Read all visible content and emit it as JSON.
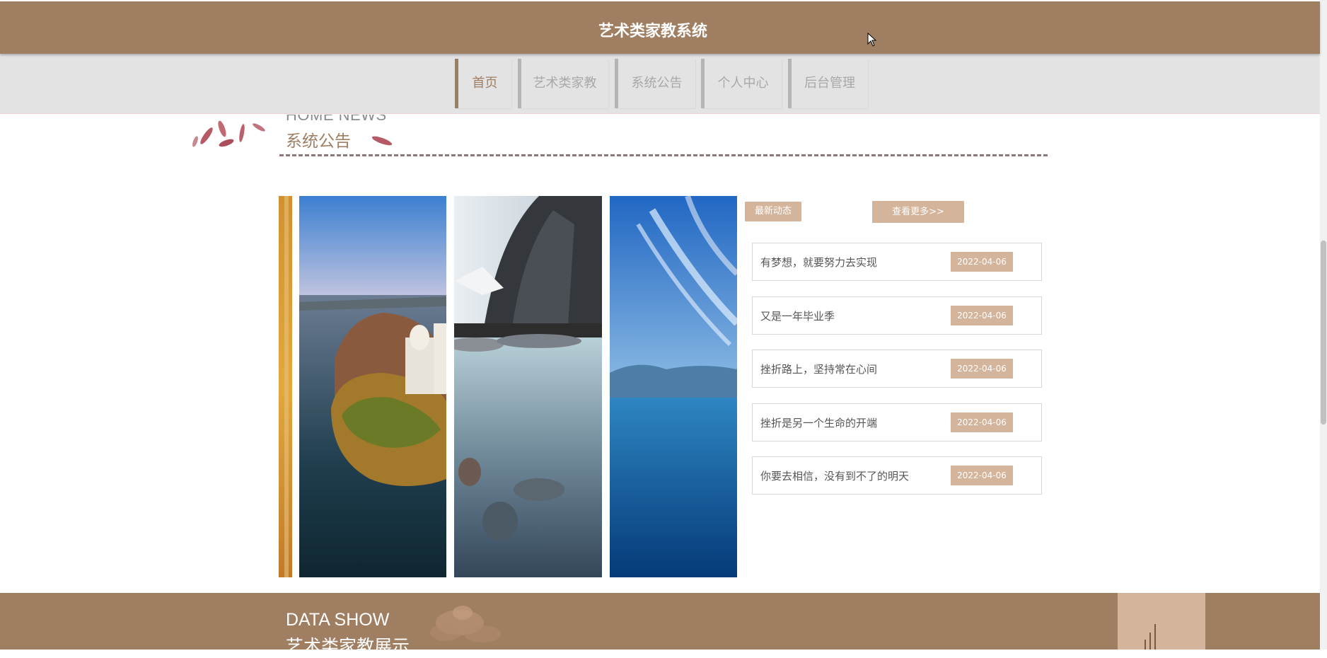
{
  "header": {
    "title": "艺术类家教系统"
  },
  "nav": [
    {
      "label": "首页",
      "active": true
    },
    {
      "label": "艺术类家教",
      "active": false
    },
    {
      "label": "系统公告",
      "active": false
    },
    {
      "label": "个人中心",
      "active": false
    },
    {
      "label": "后台管理",
      "active": false
    }
  ],
  "news_section": {
    "title_en": "HOME NEWS",
    "title_cn": "系统公告",
    "latest_label": "最新动态",
    "more_label": "查看更多>>",
    "items": [
      {
        "title": "有梦想，就要努力去实现",
        "date": "2022-04-06"
      },
      {
        "title": "又是一年毕业季",
        "date": "2022-04-06"
      },
      {
        "title": "挫折路上，坚持常在心间",
        "date": "2022-04-06"
      },
      {
        "title": "挫折是另一个生命的开端",
        "date": "2022-04-06"
      },
      {
        "title": "你要去相信，没有到不了的明天",
        "date": "2022-04-06"
      }
    ]
  },
  "data_section": {
    "title_en": "DATA SHOW",
    "title_cn": "艺术类家教展示"
  },
  "colors": {
    "brand": "#a07e62",
    "accent": "#d4b49b",
    "nav_bg": "#e3e3e3"
  },
  "icons": [
    "cursor-arrow-icon",
    "petal-decoration",
    "bar-chart-icon"
  ]
}
